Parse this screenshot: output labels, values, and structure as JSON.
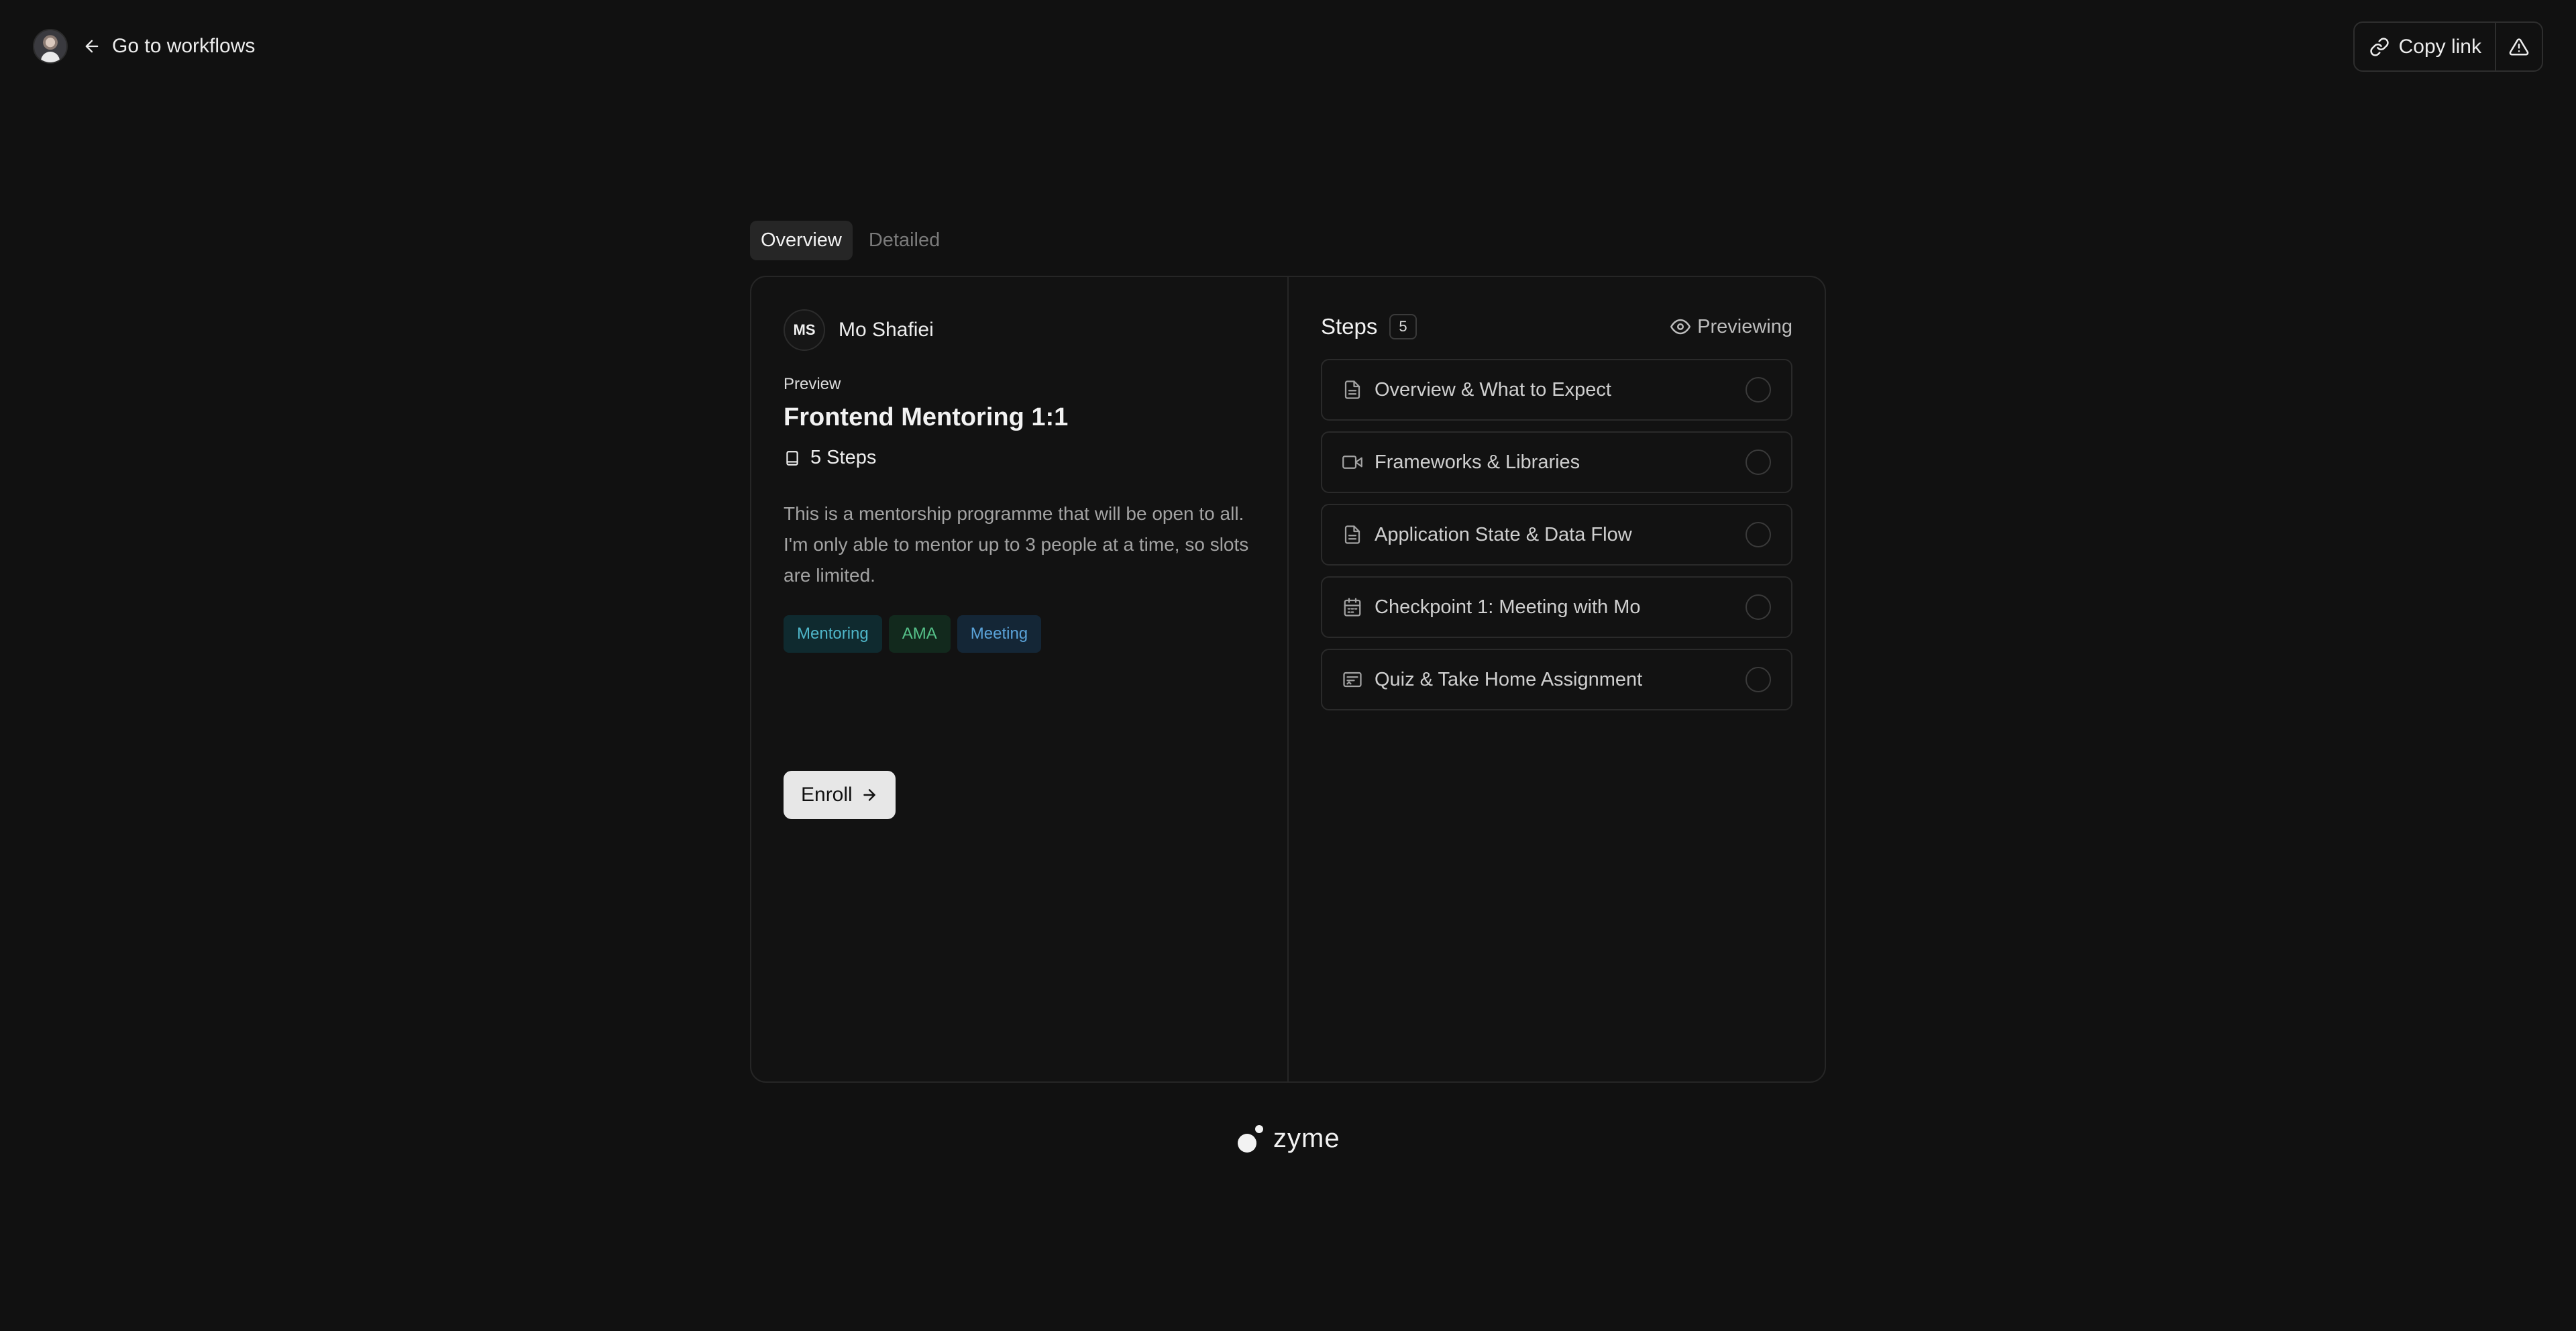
{
  "topbar": {
    "back_label": "Go to workflows",
    "copy_label": "Copy link"
  },
  "tabs": [
    {
      "label": "Overview",
      "active": true
    },
    {
      "label": "Detailed",
      "active": false
    }
  ],
  "author": {
    "initials": "MS",
    "name": "Mo Shafiei"
  },
  "course": {
    "preview_label": "Preview",
    "title": "Frontend Mentoring 1:1",
    "steps_count": "5 Steps",
    "description": "This is a mentorship programme that will be open to all. I'm only able to mentor up to 3 people at a time, so slots are limited.",
    "tags": [
      "Mentoring",
      "AMA",
      "Meeting"
    ],
    "enroll_label": "Enroll"
  },
  "steps_panel": {
    "title": "Steps",
    "count": "5",
    "mode": "Previewing",
    "items": [
      {
        "label": "Overview & What to Expect",
        "icon": "document-icon"
      },
      {
        "label": "Frameworks & Libraries",
        "icon": "video-icon"
      },
      {
        "label": "Application State & Data Flow",
        "icon": "document-icon"
      },
      {
        "label": "Checkpoint 1: Meeting with Mo",
        "icon": "calendar-icon"
      },
      {
        "label": "Quiz & Take Home Assignment",
        "icon": "quiz-icon"
      }
    ]
  },
  "footer": {
    "brand": "zyme"
  }
}
